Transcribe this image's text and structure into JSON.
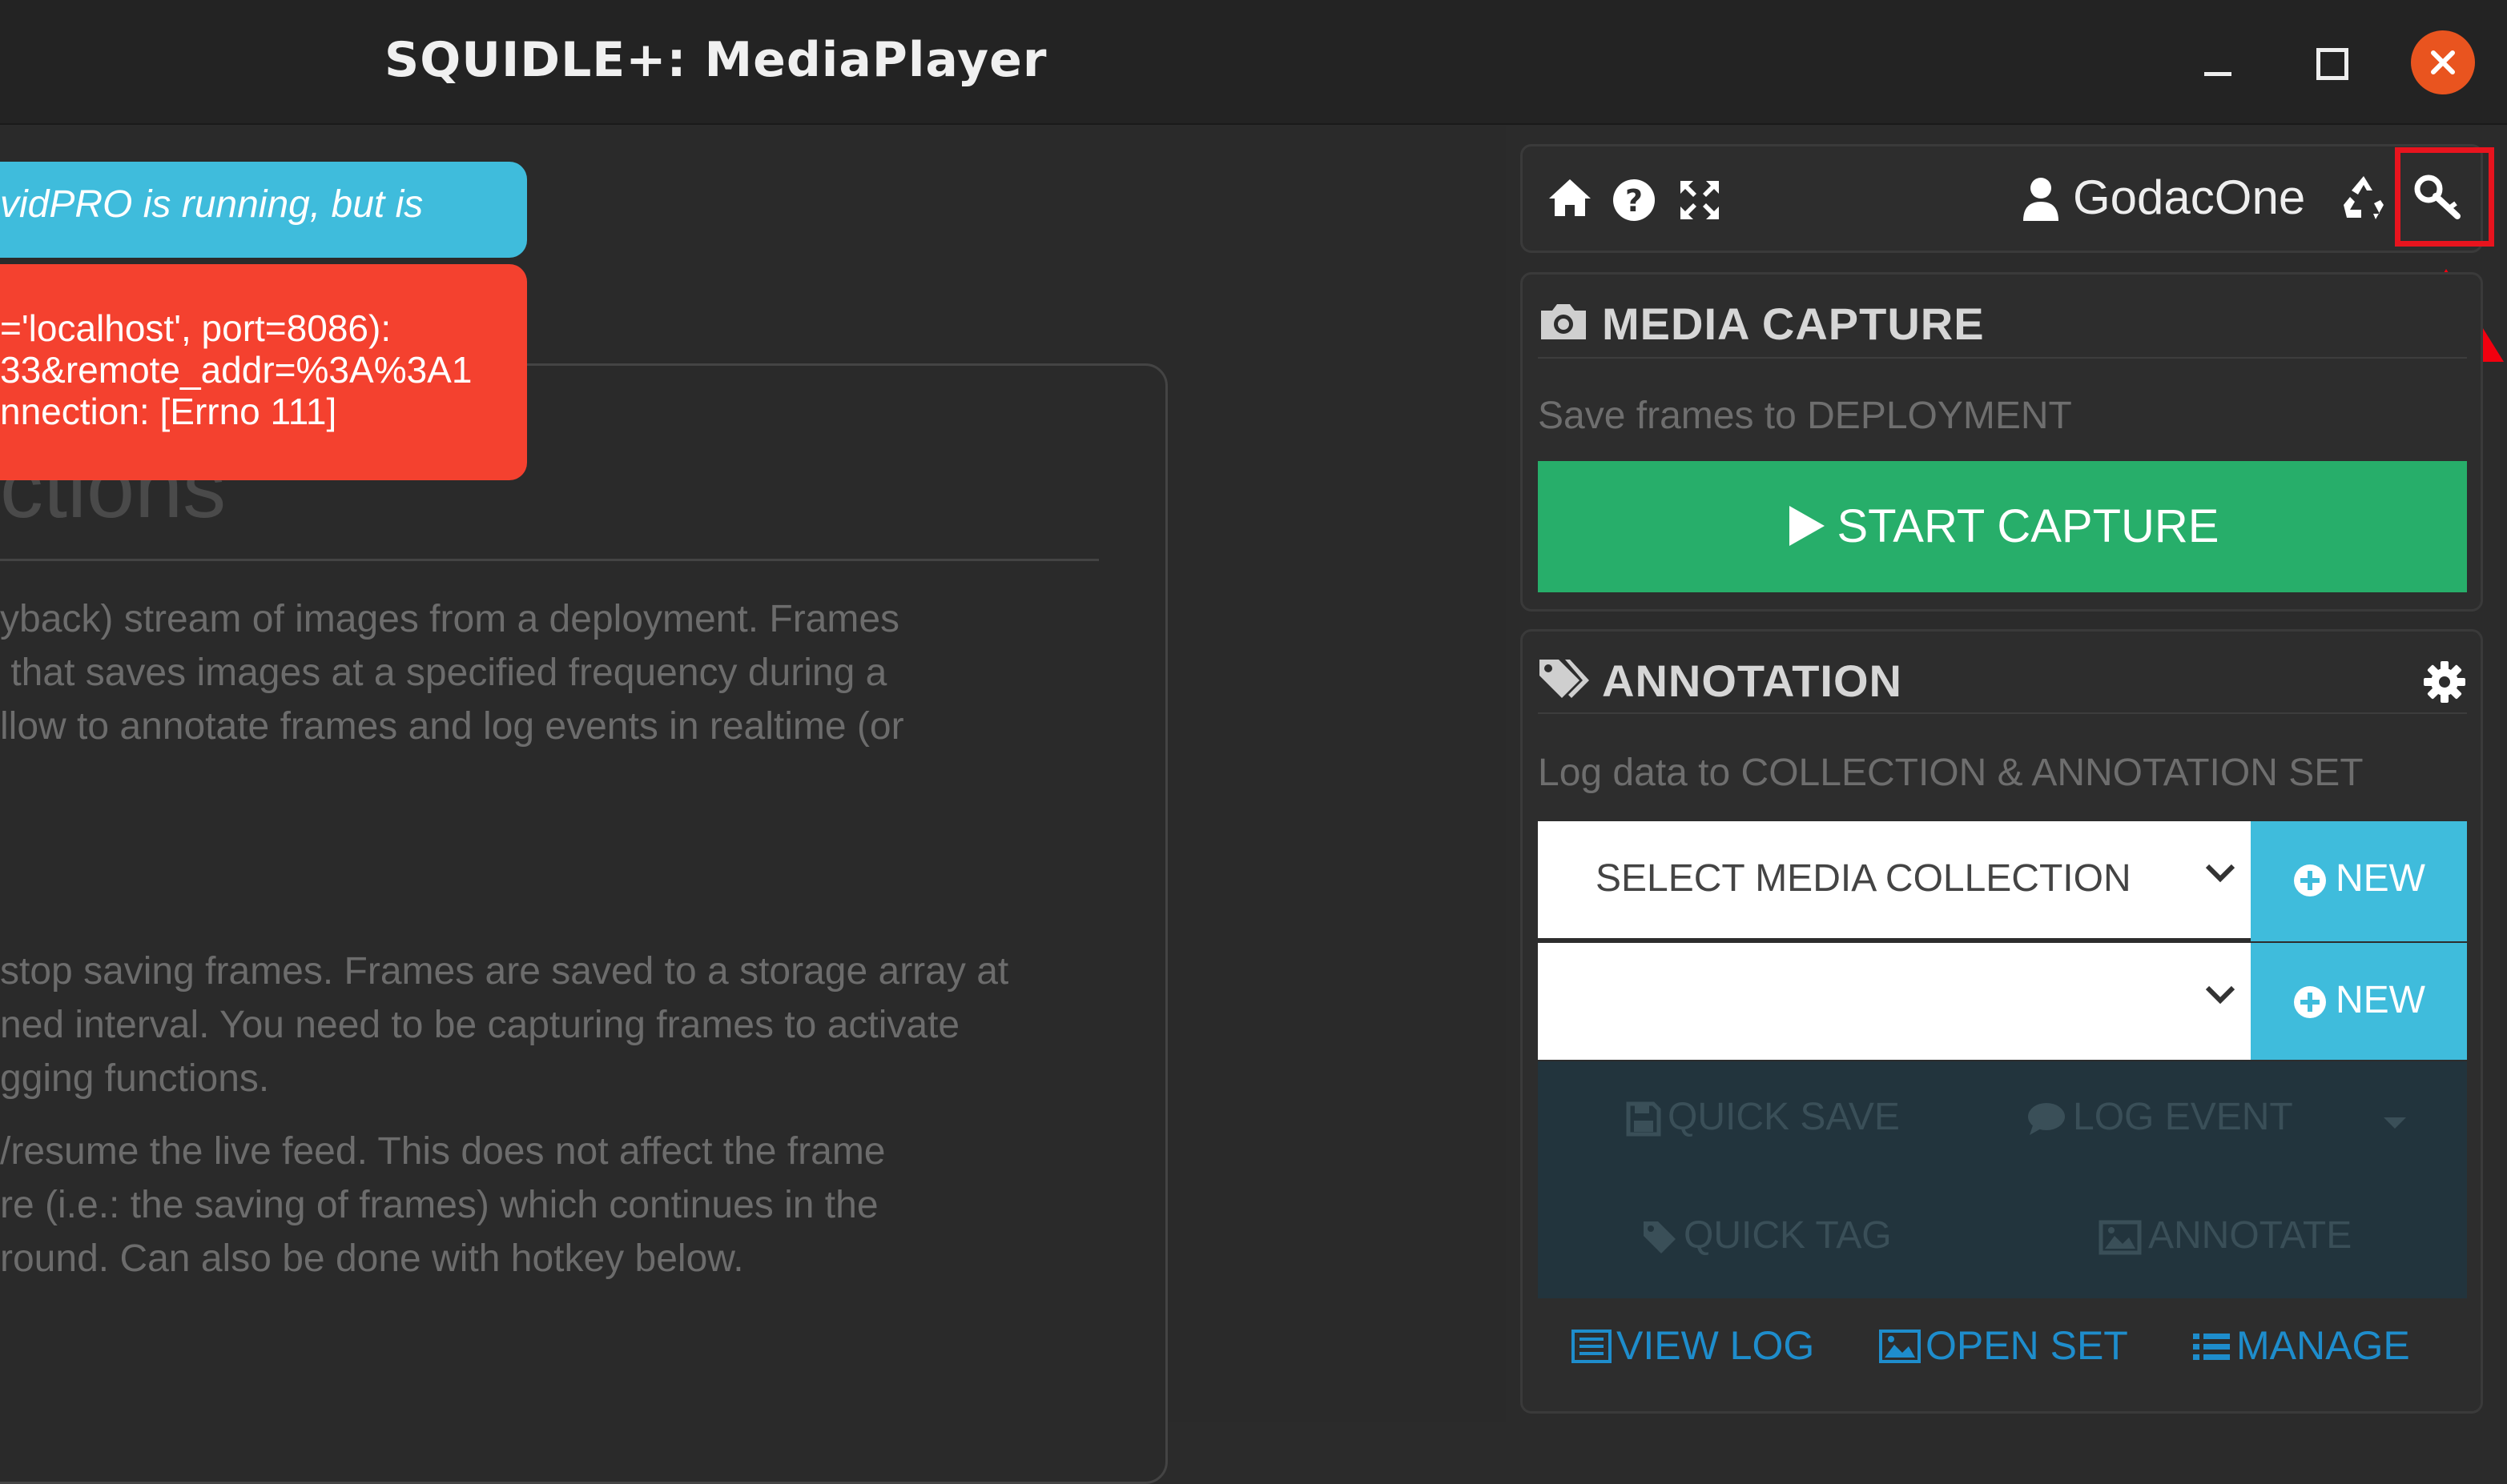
{
  "window": {
    "title": "SQUIDLE+: MediaPlayer"
  },
  "toasts": {
    "info_text": "vidPRO is running, but is",
    "error_text": "='localhost', port=8086):\n33&remote_addr=%3A%3A1\nnnection: [Errno 111]"
  },
  "instructions": {
    "heading": "ctions",
    "paragraph_1": "yback) stream of images from a deployment. Frames\n that saves images at a specified frequency during a\nllow to annotate frames and log events in realtime (or",
    "paragraph_2": "stop saving frames. Frames are saved to a storage array at\nned interval. You need to be capturing frames to activate\ngging functions.",
    "paragraph_3": "/resume the live feed. This does not affect the frame\nre (i.e.: the saving of frames) which continues in the\nround. Can also be done with hotkey below."
  },
  "top_bar": {
    "username": "GodacOne",
    "icons": [
      "home-icon",
      "help-icon",
      "expand-icon",
      "user-icon",
      "recycle-icon",
      "key-icon"
    ]
  },
  "media_capture": {
    "title": "MEDIA CAPTURE",
    "subtitle": "Save frames to DEPLOYMENT",
    "start_button": "START CAPTURE",
    "start_button_color": "#27ae6a"
  },
  "annotation": {
    "title": "ANNOTATION",
    "subtitle": "Log data to COLLECTION & ANNOTATION SET",
    "collection_select": "SELECT MEDIA COLLECTION",
    "annotation_set_select": "",
    "new_label": "NEW",
    "new_button_color": "#3fbcdc",
    "actions": {
      "quick_save": "QUICK SAVE",
      "log_event": "LOG EVENT",
      "quick_tag": "QUICK TAG",
      "annotate": "ANNOTATE"
    },
    "links": {
      "view_log": "VIEW LOG",
      "open_set": "OPEN SET",
      "manage": "MANAGE"
    }
  },
  "highlight_color": "#e8141e"
}
